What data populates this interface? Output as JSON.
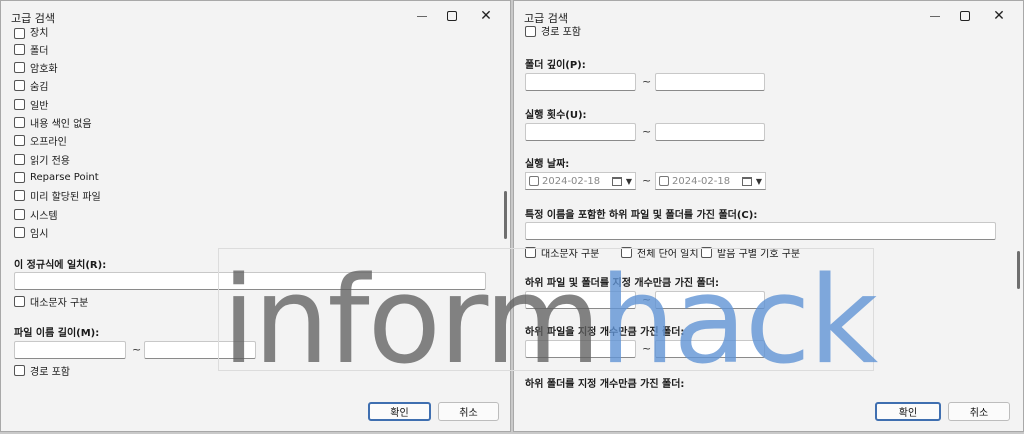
{
  "left": {
    "title": "고급 검색",
    "attributes": [
      {
        "label": "장치",
        "checked": false
      },
      {
        "label": "폴더",
        "checked": false
      },
      {
        "label": "암호화",
        "checked": false
      },
      {
        "label": "숨김",
        "checked": false
      },
      {
        "label": "일반",
        "checked": false
      },
      {
        "label": "내용 색인 없음",
        "checked": false
      },
      {
        "label": "오프라인",
        "checked": false
      },
      {
        "label": "읽기 전용",
        "checked": false
      },
      {
        "label": "Reparse Point",
        "checked": false
      },
      {
        "label": "미리 할당된 파일",
        "checked": false
      },
      {
        "label": "시스템",
        "checked": false
      },
      {
        "label": "임시",
        "checked": false
      }
    ],
    "regex_label": "이 정규식에 일치(R):",
    "regex_value": "",
    "case_label": "대소문자 구분",
    "filename_len_label": "파일 이름 길이(M):",
    "filename_len_from": "",
    "filename_len_to": "",
    "tilde": "~",
    "include_path_label": "경로 포함",
    "ok_label": "확인",
    "cancel_label": "취소"
  },
  "right": {
    "title": "고급 검색",
    "include_path_label": "경로 포함",
    "folder_depth_label": "폴더 깊이(P):",
    "run_count_label": "실행 횟수(U):",
    "run_date_label": "실행 날짜:",
    "date_from": "2024-02-18",
    "date_to": "2024-02-18",
    "subfolder_name_label": "특정 이름을 포함한 하위 파일 및 폴더를 가진 폴더(C):",
    "opt_case": "대소문자 구분",
    "opt_whole_word": "전체 단어 일치",
    "opt_diacritics": "발음 구별 기호 구분",
    "count_files_folders_label": "하위 파일 및 폴더를 지정 개수만큼 가진 폴더:",
    "count_files_label": "하위 파일을 지정 개수만큼 가진 폴더:",
    "count_folders_label": "하위 폴더를 지정 개수만큼 가진 폴더:",
    "tilde": "~",
    "ok_label": "확인",
    "cancel_label": "취소"
  },
  "watermark": {
    "part1": "inform",
    "part2": "hack"
  },
  "colors": {
    "accent": "#3f6fb0",
    "watermark_gray": "#606060",
    "watermark_blue": "#6094d4"
  }
}
